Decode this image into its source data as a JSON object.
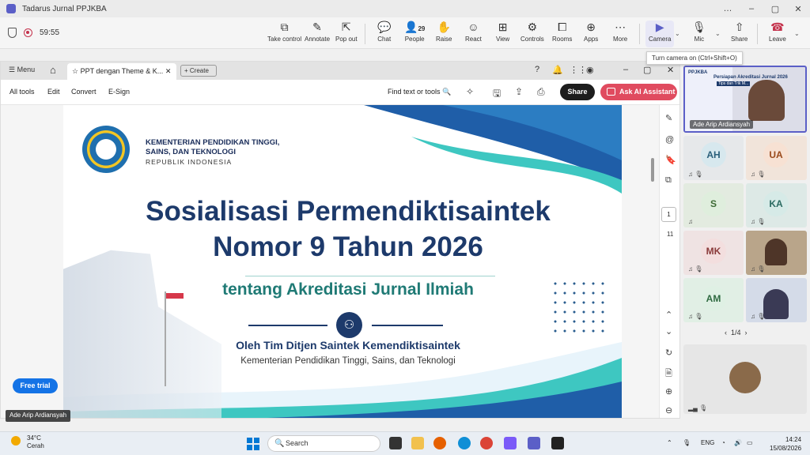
{
  "window": {
    "title": "Tadarus Jurnal PPJKBA",
    "controls": [
      "…",
      "–",
      "▢",
      "✕"
    ]
  },
  "meeting": {
    "timer": "59:55",
    "toolbar": [
      {
        "icon": "take-control-icon",
        "label": "Take control"
      },
      {
        "icon": "annotate-icon",
        "label": "Annotate"
      },
      {
        "icon": "pop-out-icon",
        "label": "Pop out"
      },
      {
        "icon": "chat-icon",
        "label": "Chat"
      },
      {
        "icon": "people-icon",
        "label": "People",
        "count": "29"
      },
      {
        "icon": "raise-hand-icon",
        "label": "Raise"
      },
      {
        "icon": "react-icon",
        "label": "React"
      },
      {
        "icon": "view-icon",
        "label": "View"
      },
      {
        "icon": "controls-icon",
        "label": "Controls"
      },
      {
        "icon": "rooms-icon",
        "label": "Rooms"
      },
      {
        "icon": "apps-icon",
        "label": "Apps"
      },
      {
        "icon": "more-icon",
        "label": "More"
      },
      {
        "icon": "camera-off-icon",
        "label": "Camera"
      },
      {
        "icon": "mic-off-icon",
        "label": "Mic"
      },
      {
        "icon": "share-screen-icon",
        "label": "Share"
      },
      {
        "icon": "leave-phone-icon",
        "label": "Leave"
      }
    ],
    "tooltip": "Turn camera on (Ctrl+Shift+O)"
  },
  "acrobat": {
    "menu": "Menu",
    "tab_title": "PPT dengan Theme & K...",
    "create": "Create",
    "tools": [
      "All tools",
      "Edit",
      "Convert",
      "E-Sign"
    ],
    "find": "Find text or tools",
    "share": "Share",
    "ask_ai": "Ask AI Assistant",
    "page_current": "1",
    "page_total": "11",
    "free_trial": "Free trial"
  },
  "slide": {
    "ministry_line1": "KEMENTERIAN PENDIDIKAN TINGGI,",
    "ministry_line2": "SAINS, DAN TEKNOLOGI",
    "ministry_line3": "REPUBLIK INDONESIA",
    "title_line1": "Sosialisasi Permendiktisaintek",
    "title_line2": "Nomor 9 Tahun 2026",
    "subtitle": "tentang Akreditasi Jurnal Ilmiah",
    "presenter": "Oleh Tim Ditjen Saintek Kemendiktisaintek",
    "presenter_sub": "Kementerian Pendidikan Tinggi, Sains, dan Teknologi"
  },
  "presenter_tag": "Ade Arip Ardiansyah",
  "gallery": {
    "main_speaker": "Ade Arip Ardiansyah",
    "main_banner_title": "Persiapan Akreditasi Jurnal 2026",
    "main_banner_sub": "Tips dan Trik M...",
    "main_logo": "PPJKBA",
    "participants": [
      {
        "initials": "AH",
        "bg": "#d7e8ee",
        "fg": "#2a5f7a"
      },
      {
        "initials": "UA",
        "bg": "#f7e1d3",
        "fg": "#9a4a1c"
      },
      {
        "initials": "S",
        "bg": "#dfeedd",
        "fg": "#3d6a35"
      },
      {
        "initials": "KA",
        "bg": "#d6eae7",
        "fg": "#2b6b62"
      },
      {
        "initials": "MK",
        "bg": "#f3dede",
        "fg": "#8a3a3a"
      },
      {
        "initials": "AM",
        "bg": "#dff0e4",
        "fg": "#2f6a41"
      }
    ],
    "page": "1/4"
  },
  "taskbar": {
    "temperature": "34°C",
    "condition": "Cerah",
    "search": "Search",
    "lang": "ENG",
    "time": "14:24",
    "date": "15/08/2026"
  }
}
